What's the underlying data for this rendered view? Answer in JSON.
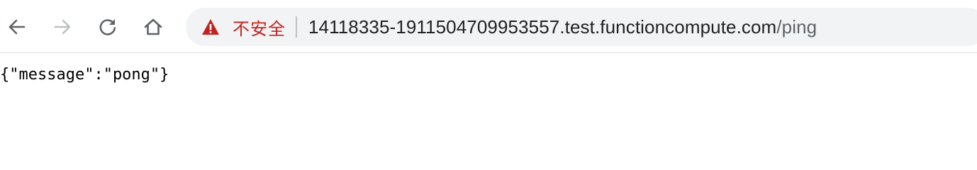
{
  "browser": {
    "security_label": "不安全",
    "url_host": "14118335-1911504709953557.test.functioncompute.com",
    "url_path": "/ping",
    "icons": {
      "back": "arrow-left-icon",
      "forward": "arrow-right-icon",
      "reload": "reload-icon",
      "home": "home-icon",
      "warning": "warning-triangle-icon"
    },
    "colors": {
      "warning": "#c5221f",
      "forward_disabled": "#bdc1c6",
      "nav_icon": "#5f6368",
      "omnibox_bg": "#f1f3f4"
    }
  },
  "page": {
    "body_text": "{\"message\":\"pong\"}"
  }
}
